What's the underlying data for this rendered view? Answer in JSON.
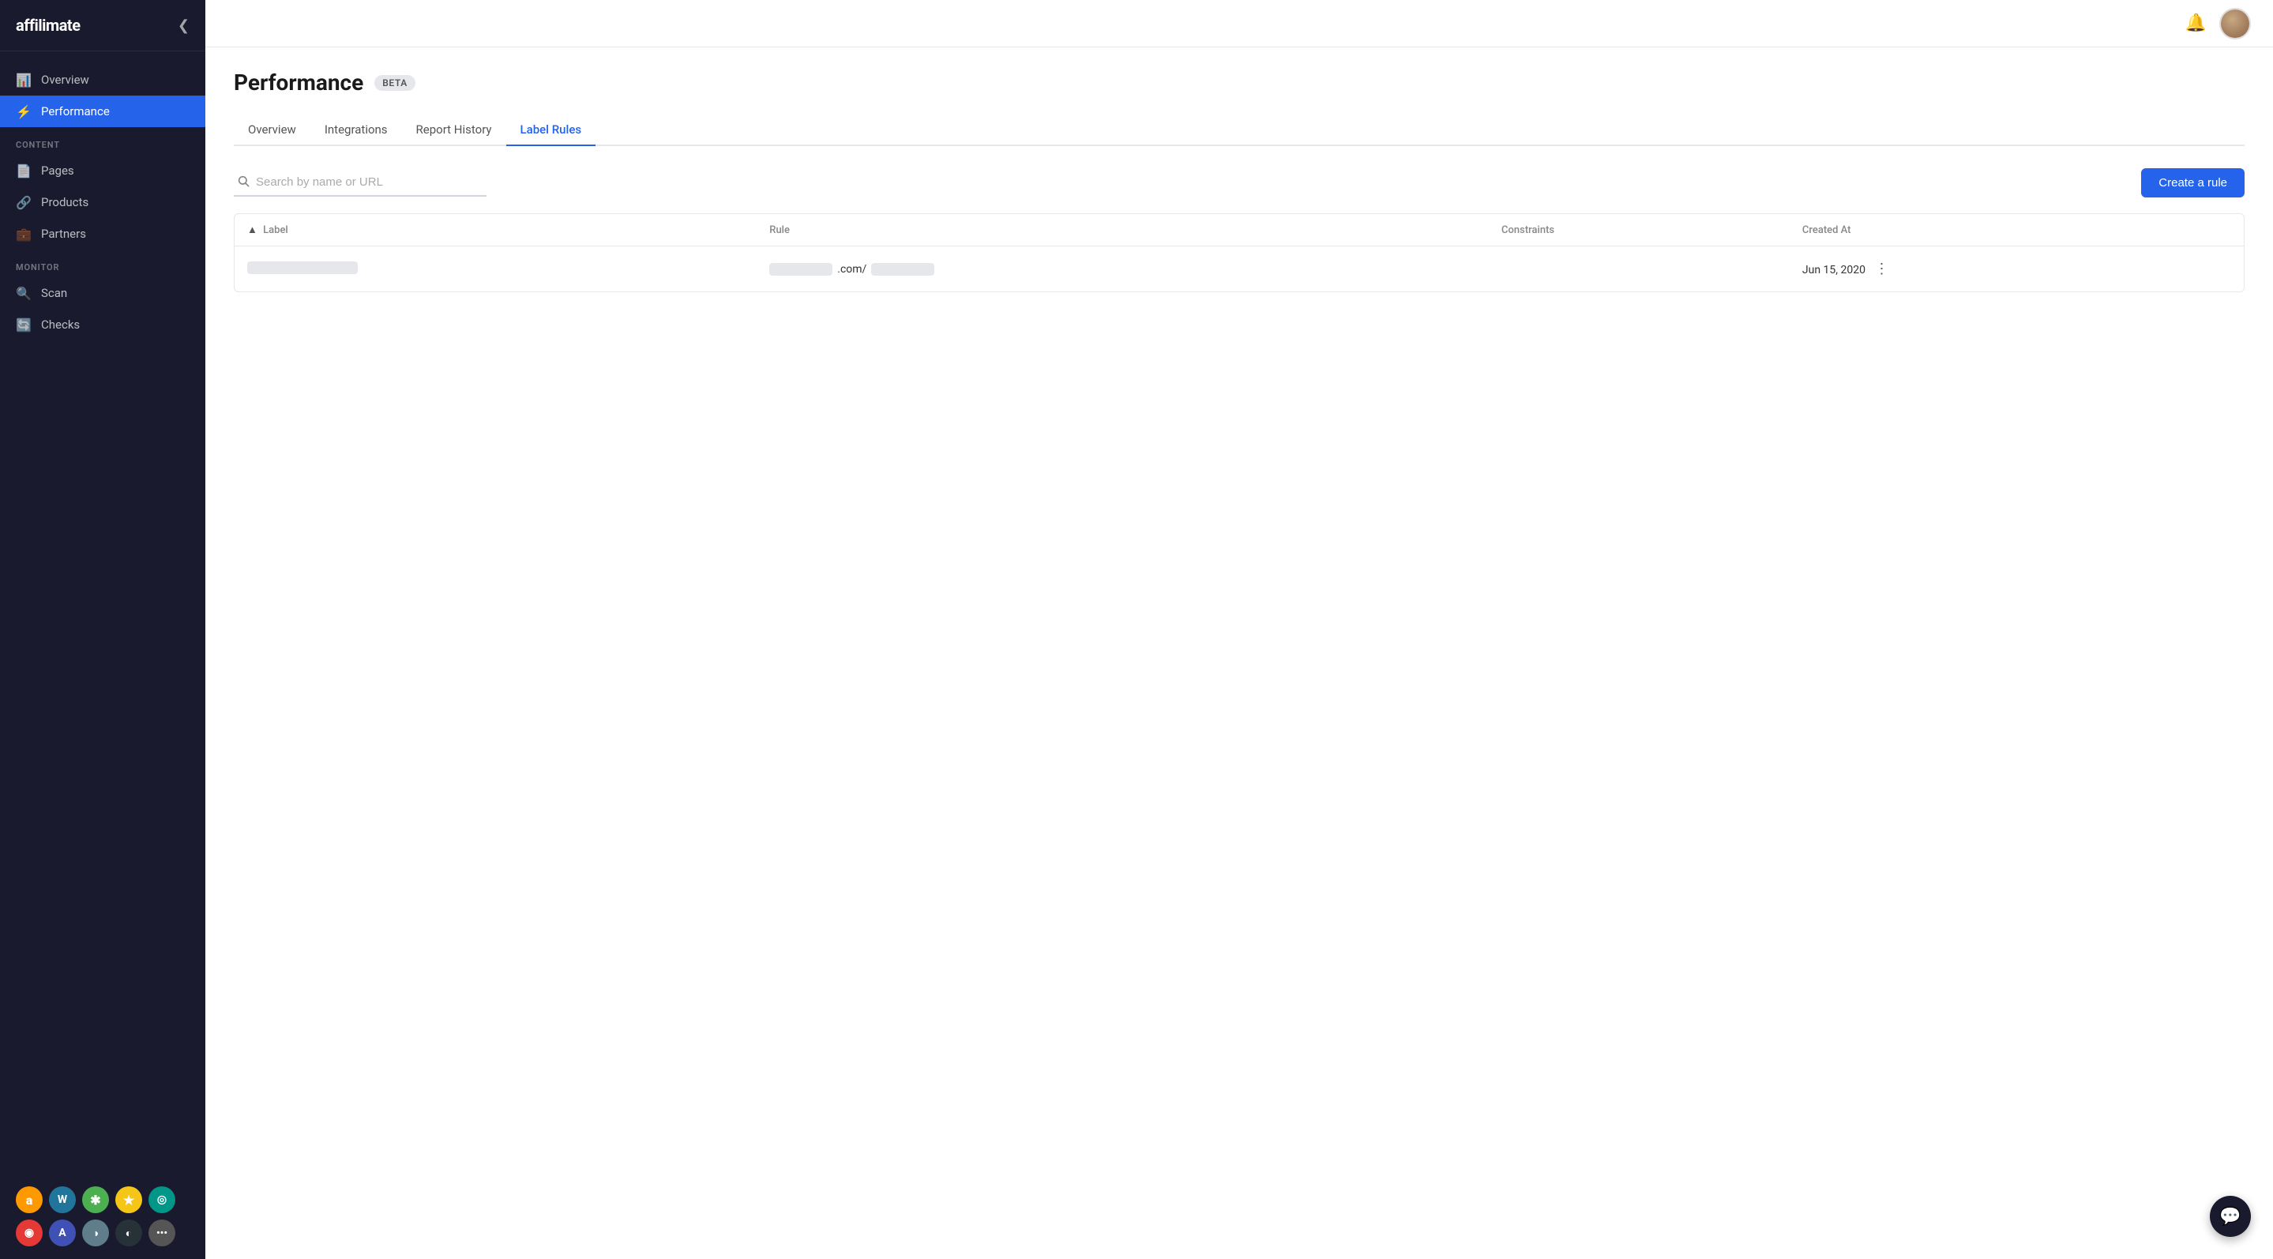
{
  "app": {
    "logo": "affilimate",
    "logo_accent": "affi"
  },
  "sidebar": {
    "toggle_icon": "❮",
    "nav_items": [
      {
        "id": "overview",
        "label": "Overview",
        "icon": "📊",
        "active": false
      },
      {
        "id": "performance",
        "label": "Performance",
        "icon": "⚡",
        "active": true
      }
    ],
    "content_section_label": "CONTENT",
    "content_items": [
      {
        "id": "pages",
        "label": "Pages",
        "icon": "📄"
      },
      {
        "id": "products",
        "label": "Products",
        "icon": "🔗"
      },
      {
        "id": "partners",
        "label": "Partners",
        "icon": "💼"
      }
    ],
    "monitor_section_label": "MONITOR",
    "monitor_items": [
      {
        "id": "scan",
        "label": "Scan",
        "icon": "🔍"
      },
      {
        "id": "checks",
        "label": "Checks",
        "icon": "🔄"
      }
    ],
    "partner_logos": [
      {
        "id": "amazon",
        "letter": "a",
        "class": "amazon"
      },
      {
        "id": "wp",
        "letter": "W",
        "class": "wp"
      },
      {
        "id": "green",
        "letter": "✱",
        "class": "green"
      },
      {
        "id": "star",
        "letter": "★",
        "class": "star"
      },
      {
        "id": "teal",
        "letter": "◎",
        "class": "teal"
      },
      {
        "id": "red",
        "letter": "◉",
        "class": "red"
      },
      {
        "id": "blue2",
        "letter": "A",
        "class": "blue2"
      },
      {
        "id": "gray1",
        "letter": "◑",
        "class": "gray2"
      },
      {
        "id": "dark",
        "letter": "◐",
        "class": "dark"
      },
      {
        "id": "more",
        "letter": "•••",
        "class": "more"
      }
    ]
  },
  "topbar": {
    "bell_icon": "🔔",
    "avatar_alt": "User avatar"
  },
  "page": {
    "title": "Performance",
    "beta_badge": "BETA",
    "tabs": [
      {
        "id": "overview",
        "label": "Overview",
        "active": false
      },
      {
        "id": "integrations",
        "label": "Integrations",
        "active": false
      },
      {
        "id": "report-history",
        "label": "Report History",
        "active": false
      },
      {
        "id": "label-rules",
        "label": "Label Rules",
        "active": true
      }
    ]
  },
  "toolbar": {
    "search_placeholder": "Search by name or URL",
    "create_button_label": "Create a rule"
  },
  "table": {
    "columns": [
      {
        "id": "label",
        "label": "Label",
        "sortable": true
      },
      {
        "id": "rule",
        "label": "Rule",
        "sortable": false
      },
      {
        "id": "constraints",
        "label": "Constraints",
        "sortable": false
      },
      {
        "id": "created_at",
        "label": "Created At",
        "sortable": false
      }
    ],
    "rows": [
      {
        "id": "row1",
        "label_skeleton": true,
        "rule_text": ".com/",
        "constraints_skeleton": false,
        "created_at": "Jun 15, 2020"
      }
    ]
  },
  "chat": {
    "icon": "💬"
  }
}
